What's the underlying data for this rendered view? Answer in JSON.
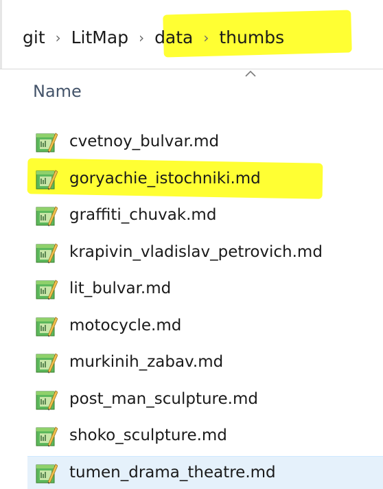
{
  "breadcrumb": {
    "items": [
      {
        "label": "git"
      },
      {
        "label": "LitMap"
      },
      {
        "label": "data"
      },
      {
        "label": "thumbs"
      }
    ],
    "separator": "›"
  },
  "columns": {
    "name_label": "Name",
    "sort": "ascending"
  },
  "files": [
    {
      "name": "cvetnoy_bulvar.md",
      "icon": "markdown-file-icon"
    },
    {
      "name": "goryachie_istochniki.md",
      "icon": "markdown-file-icon",
      "highlighted": true
    },
    {
      "name": "graffiti_chuvak.md",
      "icon": "markdown-file-icon"
    },
    {
      "name": "krapivin_vladislav_petrovich.md",
      "icon": "markdown-file-icon"
    },
    {
      "name": "lit_bulvar.md",
      "icon": "markdown-file-icon"
    },
    {
      "name": "motocycle.md",
      "icon": "markdown-file-icon"
    },
    {
      "name": "murkinih_zabav.md",
      "icon": "markdown-file-icon"
    },
    {
      "name": "post_man_sculpture.md",
      "icon": "markdown-file-icon"
    },
    {
      "name": "shoko_sculpture.md",
      "icon": "markdown-file-icon"
    },
    {
      "name": "tumen_drama_theatre.md",
      "icon": "markdown-file-icon",
      "selected": true
    }
  ],
  "colors": {
    "highlight": "#ffff33",
    "selection": "#e5f1fb",
    "header_text": "#44546a"
  }
}
